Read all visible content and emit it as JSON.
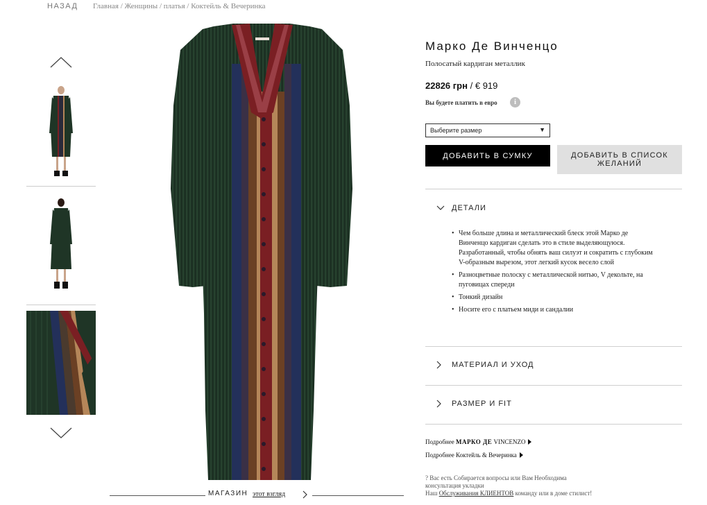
{
  "nav": {
    "back": "НАЗАД",
    "breadcrumb": [
      "Главная",
      "Женщины",
      "платья",
      "Коктейль & Вечеринка"
    ]
  },
  "gallery": {
    "thumbnails": [
      "thumb-full-front",
      "thumb-full-back",
      "thumb-detail"
    ],
    "shop_label": "МАГАЗИН",
    "shop_link": "этот взгляд"
  },
  "product": {
    "brand": "Марко Де Винченцо",
    "name": "Полосатый кардиган металлик",
    "price_uah": "22826 грн",
    "price_sep": "/",
    "price_eur": "€ 919",
    "pay_note": "Вы будете платить в евро",
    "info_icon": "i"
  },
  "actions": {
    "size_placeholder": "Выберите размер",
    "add_to_bag": "ДОБАВИТЬ В СУМКУ",
    "add_to_wishlist": "ДОБАВИТЬ В СПИСОК ЖЕЛАНИЙ"
  },
  "accordion": {
    "details_title": "ДЕТАЛИ",
    "details_items": [
      "Чем больше длина и металлический блеск этой Марко де Винченцо кардиган сделать это в стиле выделяющуюся. Разработанный, чтобы обнять ваш силуэт и сократить с глубоким V-образным вырезом, этот легкий кусок весело слой",
      "Разноцветные полоску с металлической нитью, V декольте, на пуговицах спереди",
      "Тонкий дизайн",
      "Носите его с платьем миди и сандалии"
    ],
    "care_title": "МАТЕРИАЛ И УХОД",
    "size_title": "РАЗМЕР И FIT"
  },
  "more": {
    "brand_prefix": "Подробнее",
    "brand_bold": "МАРКО ДЕ",
    "brand_rest": "VINCENZO",
    "category_prefix": "Подробнее",
    "category": "Коктейль & Вечеринка"
  },
  "help": {
    "line1": "? Вас есть Собирается вопросы или Вам Необходима консультация укладки",
    "line2_pre": "Наш",
    "line2_link": "Обслуживания КЛИЕНТОВ",
    "line2_post": "команду или в доме стилист!"
  },
  "colors": {
    "knit_green": "#1f3526",
    "stripe_red": "#7a1f23",
    "stripe_navy": "#23305a",
    "stripe_brown": "#6b4024",
    "stripe_camel": "#b58659",
    "button_black": "#000000",
    "button_grey": "#e0e0e0"
  }
}
